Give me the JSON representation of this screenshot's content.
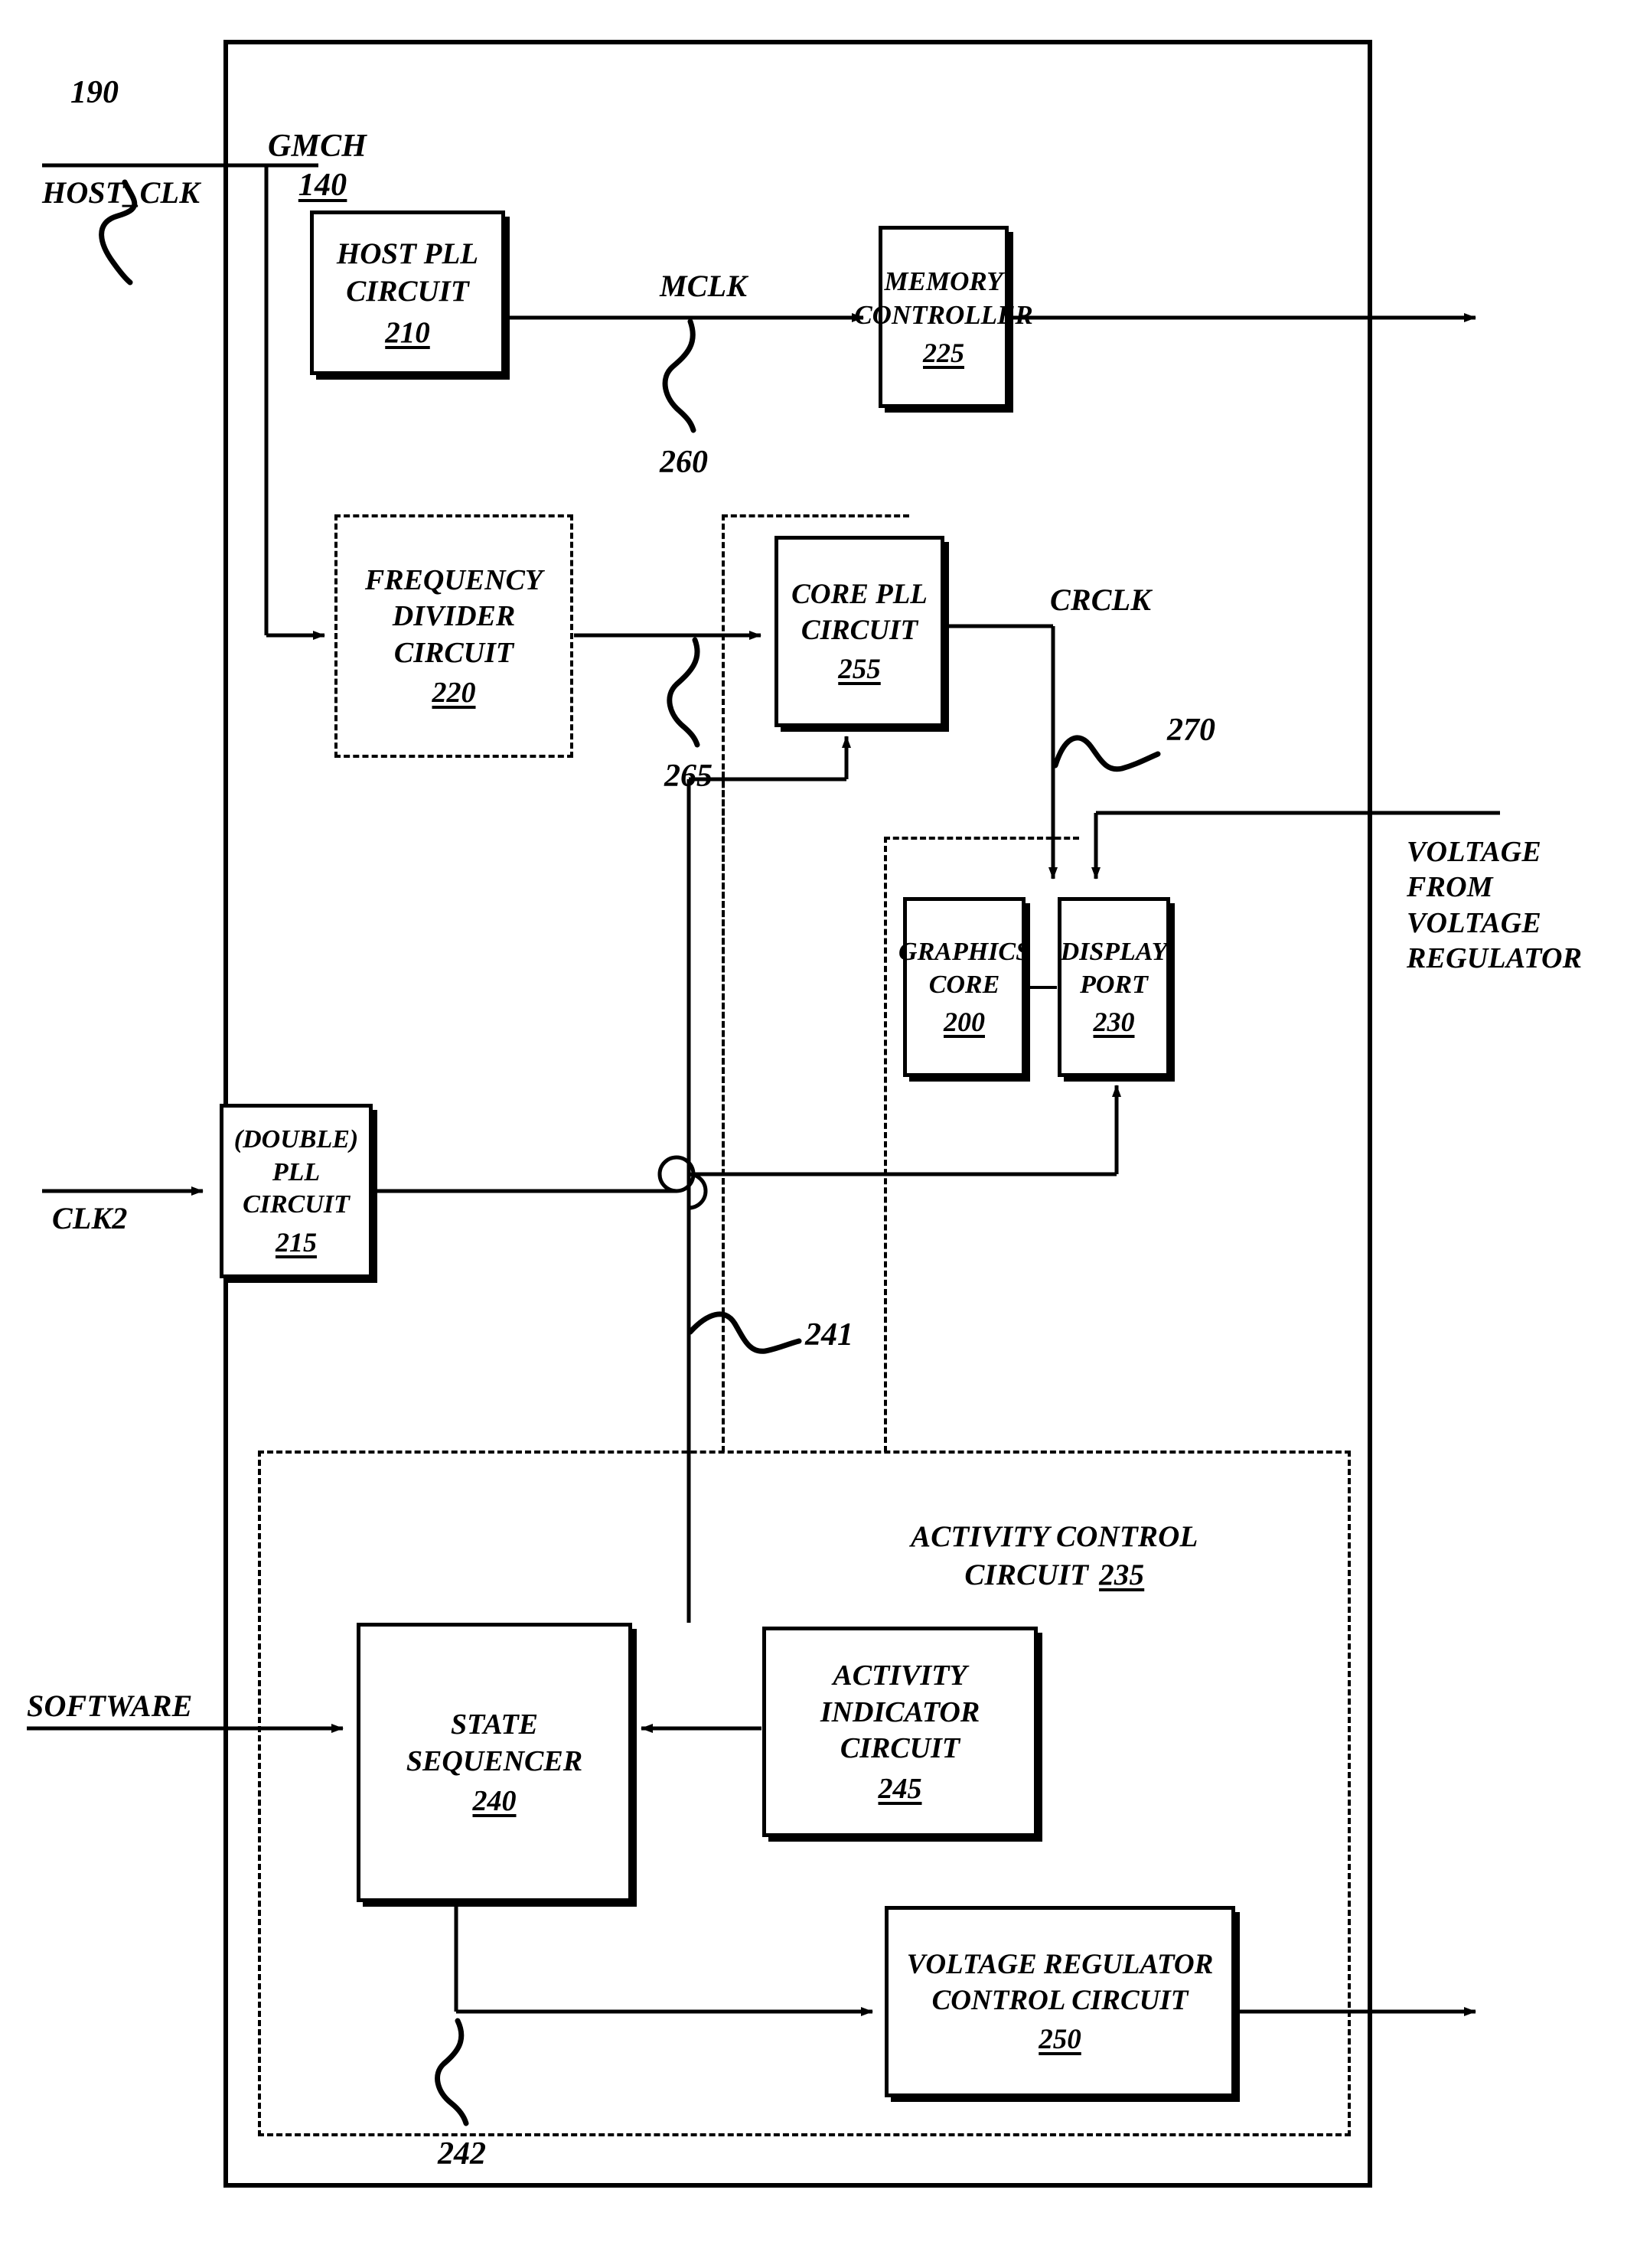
{
  "figure": {
    "container_label": "GMCH",
    "container_number": "140"
  },
  "signals": {
    "host_clk": "HOST_CLK",
    "mclk": "MCLK",
    "crclk": "CRCLK",
    "clk2": "CLK2",
    "software": "SOFTWARE",
    "voltage_note": "VOLTAGE\nFROM\nVOLTAGE\nREGULATOR"
  },
  "reference_numerals": {
    "host_clk_lead": "190",
    "mclk_lead": "260",
    "divider_out_lead": "265",
    "crclk_lead": "270",
    "sequencer_clock_lead": "241",
    "sequencer_vr_lead": "242"
  },
  "blocks": [
    {
      "id": "host_pll",
      "title": "HOST PLL\nCIRCUIT",
      "number": "210",
      "style": "solid"
    },
    {
      "id": "memctl",
      "title": "MEMORY\nCONTROLLER",
      "number": "225",
      "style": "solid"
    },
    {
      "id": "freqdiv",
      "title": "FREQUENCY\nDIVIDER\nCIRCUIT",
      "number": "220",
      "style": "dashed-inner"
    },
    {
      "id": "corepll",
      "title": "CORE PLL\nCIRCUIT",
      "number": "255",
      "style": "solid"
    },
    {
      "id": "gfxcore",
      "title": "GRAPHICS\nCORE",
      "number": "200",
      "style": "solid"
    },
    {
      "id": "dispport",
      "title": "DISPLAY\nPORT",
      "number": "230",
      "style": "solid"
    },
    {
      "id": "doublepll",
      "title": "(DOUBLE)\nPLL CIRCUIT",
      "number": "215",
      "style": "solid"
    },
    {
      "id": "statesequencer",
      "title": "STATE\nSEQUENCER",
      "number": "240",
      "style": "solid"
    },
    {
      "id": "actindicator",
      "title": "ACTIVITY\nINDICATOR\nCIRCUIT",
      "number": "245",
      "style": "solid"
    },
    {
      "id": "vrcontrol",
      "title": "VOLTAGE REGULATOR\nCONTROL CIRCUIT",
      "number": "250",
      "style": "solid"
    }
  ],
  "groups": {
    "activity_control": {
      "title": "ACTIVITY CONTROL\nCIRCUIT",
      "number": "235"
    }
  }
}
